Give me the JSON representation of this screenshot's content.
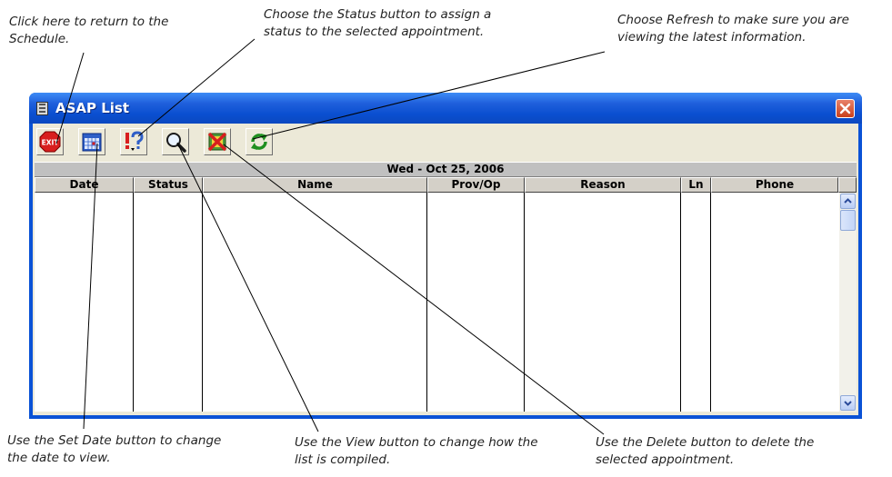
{
  "callouts": {
    "return_schedule": [
      "Click here to return to the",
      "Schedule."
    ],
    "status": [
      "Choose the Status button to assign a",
      "status to the selected appointment."
    ],
    "refresh": [
      "Choose Refresh to make sure you are",
      "viewing the latest information."
    ],
    "set_date": [
      "Use the Set Date button to change",
      "the date to view."
    ],
    "view": [
      "Use the View button to change how the",
      "list is compiled."
    ],
    "delete": [
      "Use the Delete button to delete the",
      "selected appointment."
    ]
  },
  "window": {
    "title": "ASAP List",
    "date_header": "Wed - Oct 25, 2006"
  },
  "toolbar": {
    "exit_icon_text": "EXIT",
    "buttons": [
      "exit-icon",
      "calendar-icon",
      "status-icon",
      "magnifier-icon",
      "delete-icon",
      "refresh-icon"
    ]
  },
  "columns": [
    "Date",
    "Status",
    "Name",
    "Prov/Op",
    "Reason",
    "Ln",
    "Phone"
  ]
}
